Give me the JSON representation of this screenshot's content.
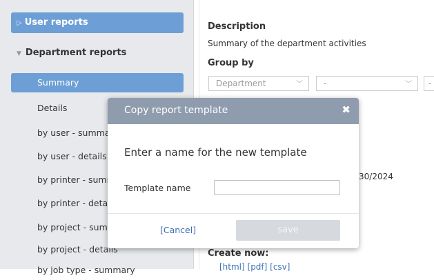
{
  "sidebar": {
    "user_reports": "User reports",
    "department_reports": "Department reports",
    "items": [
      {
        "label": "Summary"
      },
      {
        "label": "Details"
      },
      {
        "label": "by user - summary"
      },
      {
        "label": "by user - details"
      },
      {
        "label": "by printer - summary"
      },
      {
        "label": "by printer - details"
      },
      {
        "label": "by project - summary"
      },
      {
        "label": "by project - details"
      },
      {
        "label": "by job type - summary"
      }
    ]
  },
  "main": {
    "description_label": "Description",
    "description_text": "Summary of the department activities",
    "group_by_label": "Group by",
    "group_by_1": "Department",
    "group_by_2": "-",
    "group_by_3": "-",
    "date_partial": "30/2024",
    "create_now_label": "Create now:",
    "create_links": "[html]    [pdf]    [csv]"
  },
  "modal": {
    "title": "Copy report template",
    "prompt": "Enter a name for the new template",
    "field_label": "Template name",
    "field_value": "",
    "cancel_label": "[Cancel]",
    "save_label": "save"
  }
}
